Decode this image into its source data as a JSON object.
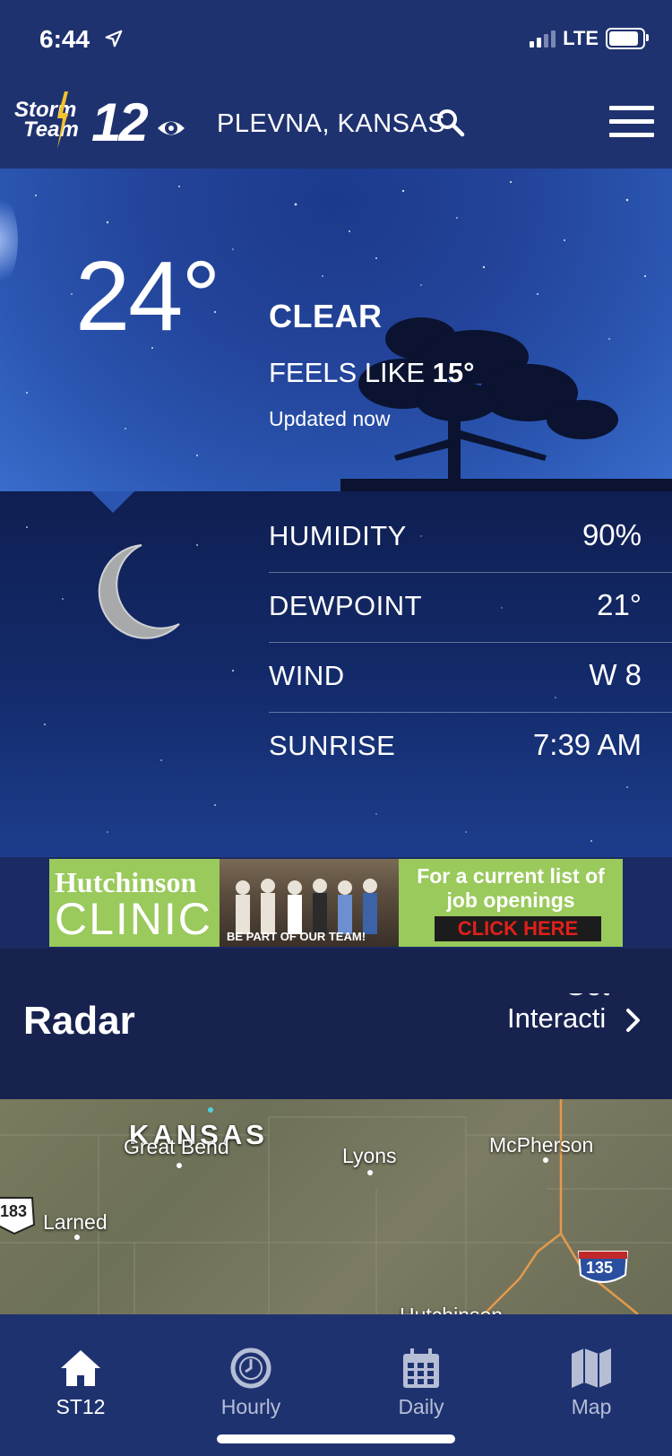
{
  "status_bar": {
    "time": "6:44",
    "network": "LTE",
    "icons": [
      "location-arrow-icon",
      "cellular-signal-icon",
      "battery-icon"
    ]
  },
  "header": {
    "logo_text_line1": "Storm",
    "logo_text_line2": "Team",
    "logo_number": "12",
    "location": "PLEVNA, KANSAS",
    "icons": [
      "search-icon",
      "menu-icon"
    ]
  },
  "current": {
    "temperature": "24°",
    "condition": "CLEAR",
    "feels_like_label": "FEELS LIKE",
    "feels_like_value": "15°",
    "updated": "Updated now",
    "condition_icon": "moon-icon"
  },
  "stats": [
    {
      "label": "HUMIDITY",
      "value": "90%"
    },
    {
      "label": "DEWPOINT",
      "value": "21°"
    },
    {
      "label": "WIND",
      "value": "W 8"
    },
    {
      "label": "SUNRISE",
      "value": "7:39 AM"
    }
  ],
  "ad": {
    "brand_line1": "Hutchinson",
    "brand_line2": "CLINIC",
    "photo_caption": "BE PART OF OUR TEAM!",
    "text": "For a current list of job openings",
    "cta": "CLICK HERE",
    "accent_color": "#9ac95c"
  },
  "radar": {
    "title": "Radar",
    "link_ghost": "Get",
    "link_text": "Interacti"
  },
  "map": {
    "state": "KANSAS",
    "cities": [
      "Great Bend",
      "Lyons",
      "McPherson",
      "Larned",
      "Hutchinson"
    ],
    "shields": [
      "183",
      "135"
    ]
  },
  "tabs": [
    {
      "label": "ST12",
      "icon": "home-icon",
      "active": true
    },
    {
      "label": "Hourly",
      "icon": "clock-icon",
      "active": false
    },
    {
      "label": "Daily",
      "icon": "calendar-icon",
      "active": false
    },
    {
      "label": "Map",
      "icon": "map-icon",
      "active": false
    }
  ],
  "colors": {
    "bar_background": "#1f3270",
    "radar_header": "#17224f"
  }
}
